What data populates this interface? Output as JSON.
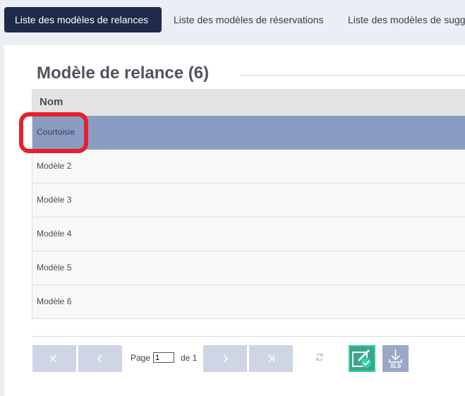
{
  "tabs": [
    {
      "label": "Liste des modèles de relances",
      "active": true
    },
    {
      "label": "Liste des modèles de réservations",
      "active": false
    },
    {
      "label": "Liste des modèles de sugg",
      "active": false
    }
  ],
  "panel": {
    "title": "Modèle de relance (6)",
    "grid": {
      "column_header": "Nom",
      "rows": [
        "Courtoisie",
        "Modèle 2",
        "Modèle 3",
        "Modèle 4",
        "Modèle 5",
        "Modèle 6"
      ],
      "selected_index": 0
    }
  },
  "pager": {
    "page_label": "Page",
    "current_page": "1",
    "of_label": "de 1",
    "first_icon": "first-page-icon",
    "prev_icon": "prev-page-icon",
    "next_icon": "next-page-icon",
    "last_icon": "last-page-icon",
    "refresh_icon": "refresh-icon",
    "check_icon": "edit-check-icon",
    "export_label": "XLS",
    "export_icon": "download-icon"
  },
  "colors": {
    "active_tab": "#1d2a48",
    "selected_row": "#8b9cc3",
    "pager_button": "#cfd5e5",
    "highlight": "#e81e2c",
    "check_button": "#3fa28b"
  }
}
